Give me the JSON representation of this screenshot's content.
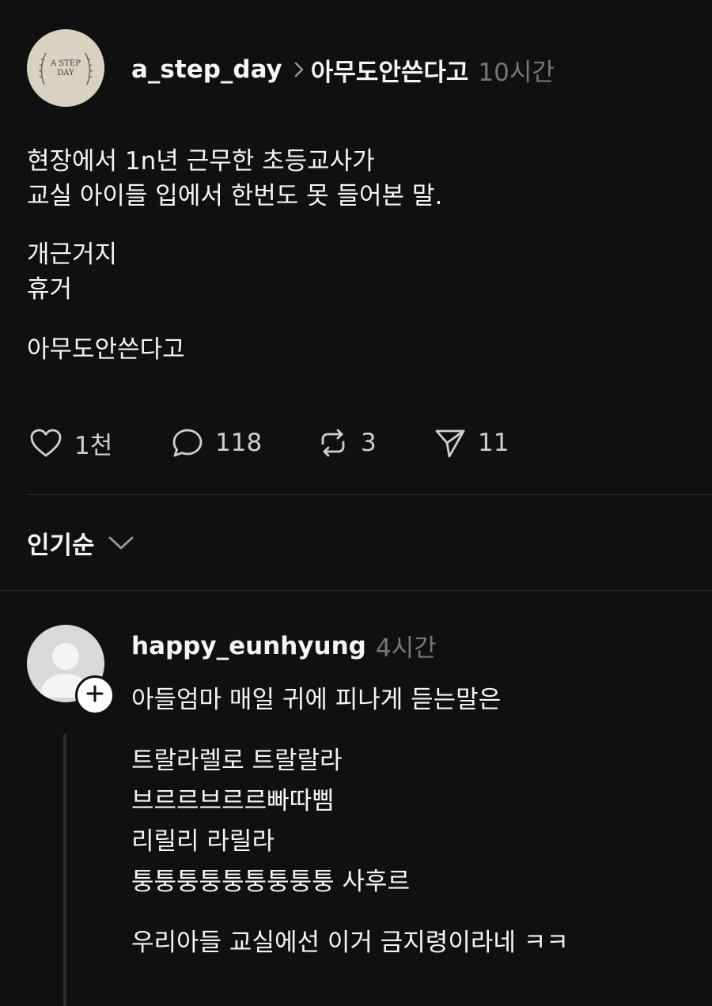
{
  "post": {
    "author": "a_step_day",
    "topic": "아무도안쓴다고",
    "time": "10시간",
    "avatar_text_line1": "A STEP",
    "avatar_text_line2": "DAY",
    "lines": [
      "현장에서 1n년 근무한 초등교사가",
      "교실 아이들 입에서 한번도 못 들어본 말.",
      "개근거지",
      "휴거",
      "아무도안쓴다고"
    ]
  },
  "actions": {
    "like_count": "1천",
    "reply_count": "118",
    "repost_count": "3",
    "share_count": "11"
  },
  "sort": {
    "label": "인기순"
  },
  "comment": {
    "author": "happy_eunhyung",
    "time": "4시간",
    "lines": [
      "아들엄마 매일 귀에 피나게 듣는말은",
      "트랄라렐로 트랄랄라",
      "브르르브르르빠따삠",
      "리릴리 라릴라",
      "퉁퉁퉁퉁퉁퉁퉁퉁퉁 사후르",
      "우리아들 교실에선 이거 금지령이라네 ㅋㅋ"
    ]
  },
  "colors": {
    "background": "#101010",
    "text": "#f3f5f7",
    "muted": "#777777",
    "divider": "#2e2e2e"
  }
}
